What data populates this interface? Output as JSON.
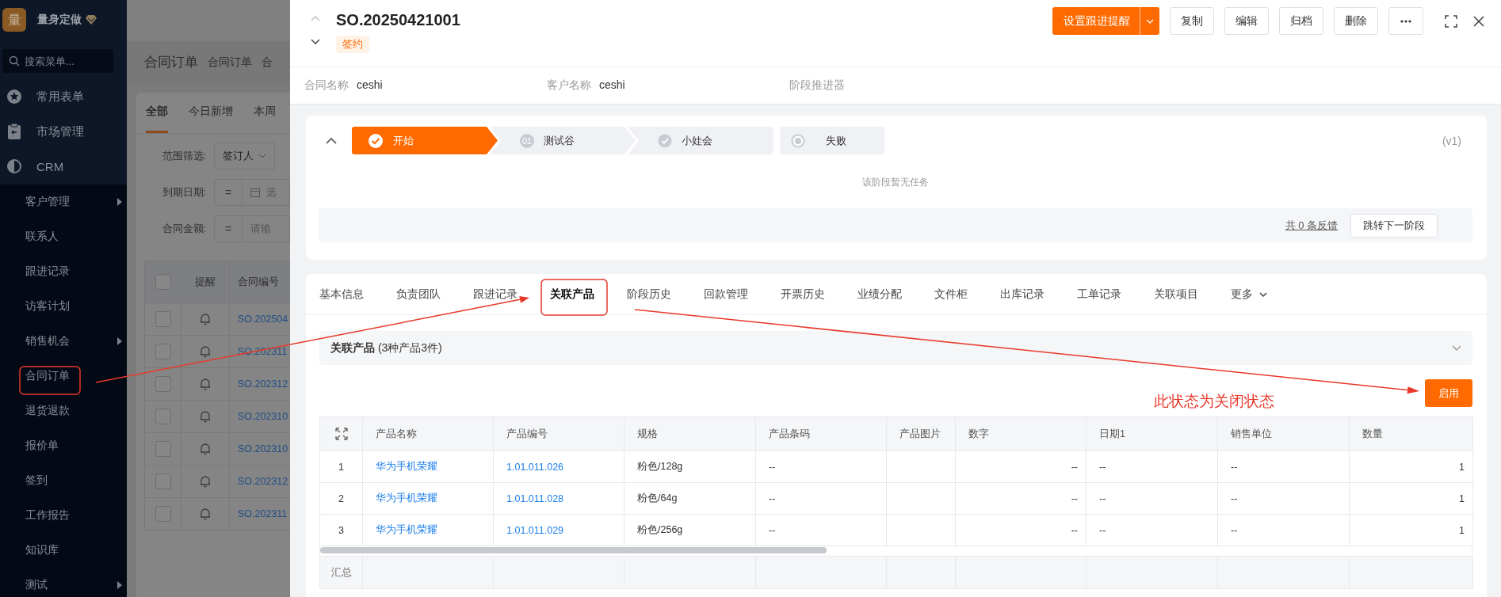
{
  "sidebar": {
    "logo": "量",
    "brand": "量身定做",
    "search": {
      "placeholder": "搜索菜单..."
    },
    "items": [
      {
        "label": "常用表单"
      },
      {
        "label": "市场管理"
      },
      {
        "label": "CRM"
      }
    ],
    "submenu": [
      {
        "label": "客户管理",
        "has_children": true
      },
      {
        "label": "联系人",
        "has_children": false
      },
      {
        "label": "跟进记录",
        "has_children": false
      },
      {
        "label": "访客计划",
        "has_children": false
      },
      {
        "label": "销售机会",
        "has_children": true
      },
      {
        "label": "合同订单",
        "has_children": false
      },
      {
        "label": "退货退款",
        "has_children": false
      },
      {
        "label": "报价单",
        "has_children": false
      },
      {
        "label": "签到",
        "has_children": false
      },
      {
        "label": "工作报告",
        "has_children": false
      },
      {
        "label": "知识库",
        "has_children": false
      },
      {
        "label": "测试",
        "has_children": true
      }
    ]
  },
  "background_page": {
    "title": "合同订单",
    "header_tabs": [
      "合同订单",
      "合"
    ],
    "tabs": [
      {
        "label": "全部",
        "selected": true
      },
      {
        "label": "今日新增",
        "selected": false
      },
      {
        "label": "本周",
        "selected": false
      }
    ],
    "filters": [
      {
        "label": "范围筛选:",
        "kind": "select",
        "value": "签订人"
      },
      {
        "label": "到期日期:",
        "kind": "date",
        "operator": "=",
        "placeholder": "选"
      },
      {
        "label": "合同金额:",
        "kind": "input",
        "operator": "=",
        "placeholder": "请输"
      }
    ],
    "table": {
      "columns": [
        "提醒",
        "合同编号"
      ],
      "all_checked": false,
      "rows": [
        {
          "number": "SO.202504",
          "checked": false
        },
        {
          "number": "SO.202311",
          "checked": false
        },
        {
          "number": "SO.202312",
          "checked": false
        },
        {
          "number": "SO.202310",
          "checked": false
        },
        {
          "number": "SO.202310",
          "checked": false
        },
        {
          "number": "SO.202312",
          "checked": false
        },
        {
          "number": "SO.202311",
          "checked": false
        }
      ]
    }
  },
  "drawer": {
    "title": "SO.20250421001",
    "tag": "签约",
    "primary_action": "设置跟进提醒",
    "actions": [
      "复制",
      "编辑",
      "归档",
      "删除"
    ],
    "fields": [
      {
        "label": "合同名称",
        "value": "ceshi"
      },
      {
        "label": "客户名称",
        "value": "ceshi"
      },
      {
        "label": "阶段推进器"
      }
    ],
    "stages": {
      "items": [
        {
          "label": "开始",
          "kind": "active"
        },
        {
          "label": "测试谷",
          "kind": "numbered",
          "number": "01"
        },
        {
          "label": "小娃会",
          "kind": "checked"
        },
        {
          "label": "失败",
          "kind": "end"
        }
      ],
      "version": "(v1)",
      "empty_text": "该阶段暂无任务",
      "feedback_link": "共 0 条反馈",
      "next_button": "跳转下一阶段"
    },
    "tabs": [
      {
        "label": "基本信息",
        "selected": false
      },
      {
        "label": "负责团队",
        "selected": false
      },
      {
        "label": "跟进记录",
        "selected": false
      },
      {
        "label": "关联产品",
        "selected": true
      },
      {
        "label": "阶段历史",
        "selected": false
      },
      {
        "label": "回款管理",
        "selected": false
      },
      {
        "label": "开票历史",
        "selected": false
      },
      {
        "label": "业绩分配",
        "selected": false
      },
      {
        "label": "文件柜",
        "selected": false
      },
      {
        "label": "出库记录",
        "selected": false
      },
      {
        "label": "工单记录",
        "selected": false
      },
      {
        "label": "关联项目",
        "selected": false
      }
    ],
    "more_tab": "更多",
    "products": {
      "title": "**关联产品** (3种产品3件)",
      "button": "启用",
      "columns": [
        {
          "label": "产品名称",
          "kind": "link"
        },
        {
          "label": "产品编号",
          "kind": "link"
        },
        {
          "label": "规格",
          "kind": "text"
        },
        {
          "label": "产品条码",
          "kind": "text"
        },
        {
          "label": "产品图片",
          "kind": "text"
        },
        {
          "label": "数字",
          "kind": "number"
        },
        {
          "label": "日期1",
          "kind": "text"
        },
        {
          "label": "销售单位",
          "kind": "text"
        },
        {
          "label": "数量",
          "kind": "number"
        }
      ],
      "rows": [
        {
          "index": "1",
          "cells": [
            "华为手机荣耀",
            "1.01.011.026",
            "粉色/128g",
            "--",
            null,
            "--",
            "--",
            "--",
            "1"
          ]
        },
        {
          "index": "2",
          "cells": [
            "华为手机荣耀",
            "1.01.011.028",
            "粉色/64g",
            "--",
            null,
            "--",
            "--",
            "--",
            "1"
          ]
        },
        {
          "index": "3",
          "cells": [
            "华为手机荣耀",
            "1.01.011.029",
            "粉色/256g",
            "--",
            null,
            "--",
            "--",
            "--",
            "1"
          ]
        }
      ],
      "summary_label": "汇总"
    }
  },
  "annotation": {
    "note": "此状态为关闭状态"
  }
}
